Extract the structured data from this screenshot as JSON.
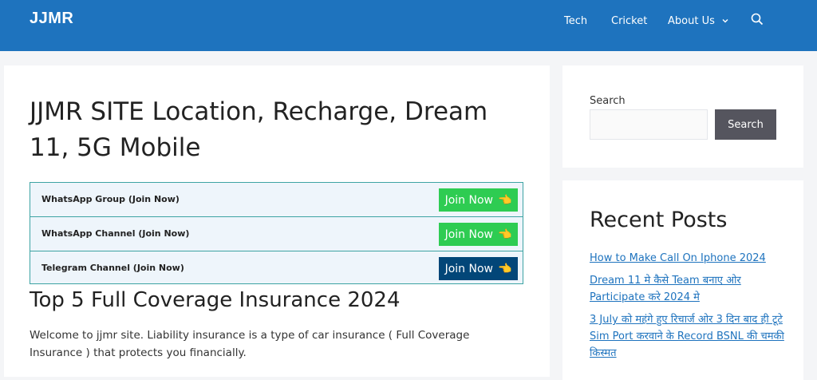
{
  "header": {
    "logo": "JJMR",
    "nav": [
      "Tech",
      "Cricket",
      "About Us"
    ],
    "icons": {
      "dropdown": "chevron-down-icon",
      "search": "search-icon"
    },
    "colors": {
      "bar": "#1e73be",
      "text": "#ffffff"
    }
  },
  "article": {
    "title": "JJMR SITE Location, Recharge, Dream 11, 5G Mobile",
    "join_rows": [
      {
        "label": "WhatsApp Group (Join Now)",
        "button": "Join Now",
        "color": "#2ecc52"
      },
      {
        "label": "WhatsApp Channel (Join Now)",
        "button": "Join Now",
        "color": "#2ecc52"
      },
      {
        "label": "Telegram Channel (Join Now)",
        "button": "Join Now",
        "color": "#024678"
      }
    ],
    "hand_icon": "👈",
    "section_title": "Top 5 Full Coverage Insurance 2024",
    "intro": "Welcome to jjmr site. Liability insurance is a type of car insurance ( Full Coverage Insurance ) that protects you financially."
  },
  "sidebar": {
    "search": {
      "label": "Search",
      "placeholder": "",
      "button": "Search"
    },
    "recent": {
      "title": "Recent Posts",
      "posts": [
        "How to Make Call On Iphone 2024",
        "Dream 11 मे कैसे Team बनाए ओर Participate करे 2024 मे",
        "3 July को महंगे हुए रिचार्ज ओर 3 दिन बाद ही टूटे Sim Port करवाने के Record BSNL की चमकी किस्मत"
      ]
    }
  }
}
